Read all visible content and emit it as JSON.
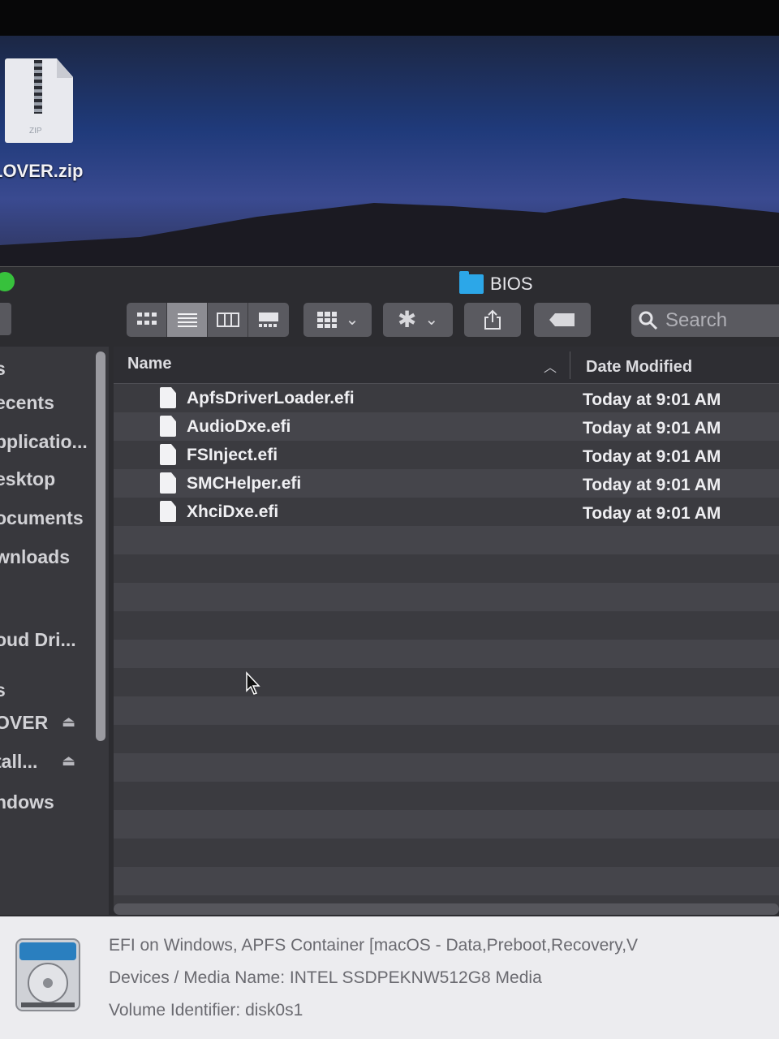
{
  "desktop": {
    "zip_file": {
      "label": "LOVER.zip",
      "tag": "ZIP",
      "icon": "zip-file-icon"
    }
  },
  "window": {
    "title": "BIOS",
    "folder_color": "#2ca7e8"
  },
  "toolbar": {
    "view_buttons": [
      "icon-view",
      "list-view",
      "column-view",
      "gallery-view"
    ],
    "active_view": "list-view",
    "search_placeholder": "Search"
  },
  "sidebar": {
    "items": [
      {
        "label": "s"
      },
      {
        "label": "ecents"
      },
      {
        "label": "pplicatio..."
      },
      {
        "label": "esktop"
      },
      {
        "label": "ocuments"
      },
      {
        "label": "wnloads"
      },
      {
        "label": "oud Dri..."
      },
      {
        "label": "s"
      },
      {
        "label": "OVER"
      },
      {
        "label": "tall..."
      },
      {
        "label": "ndows"
      }
    ]
  },
  "columns": {
    "name": "Name",
    "date": "Date Modified"
  },
  "files": [
    {
      "name": "ApfsDriverLoader.efi",
      "date": "Today at 9:01 AM"
    },
    {
      "name": "AudioDxe.efi",
      "date": "Today at 9:01 AM"
    },
    {
      "name": "FSInject.efi",
      "date": "Today at 9:01 AM"
    },
    {
      "name": "SMCHelper.efi",
      "date": "Today at 9:01 AM"
    },
    {
      "name": "XhciDxe.efi",
      "date": "Today at 9:01 AM"
    }
  ],
  "info_panel": {
    "line1": "EFI on Windows, APFS Container [macOS - Data,Preboot,Recovery,V",
    "line2": "Devices / Media Name: INTEL SSDPEKNW512G8 Media",
    "line3": "Volume Identifier: disk0s1"
  }
}
